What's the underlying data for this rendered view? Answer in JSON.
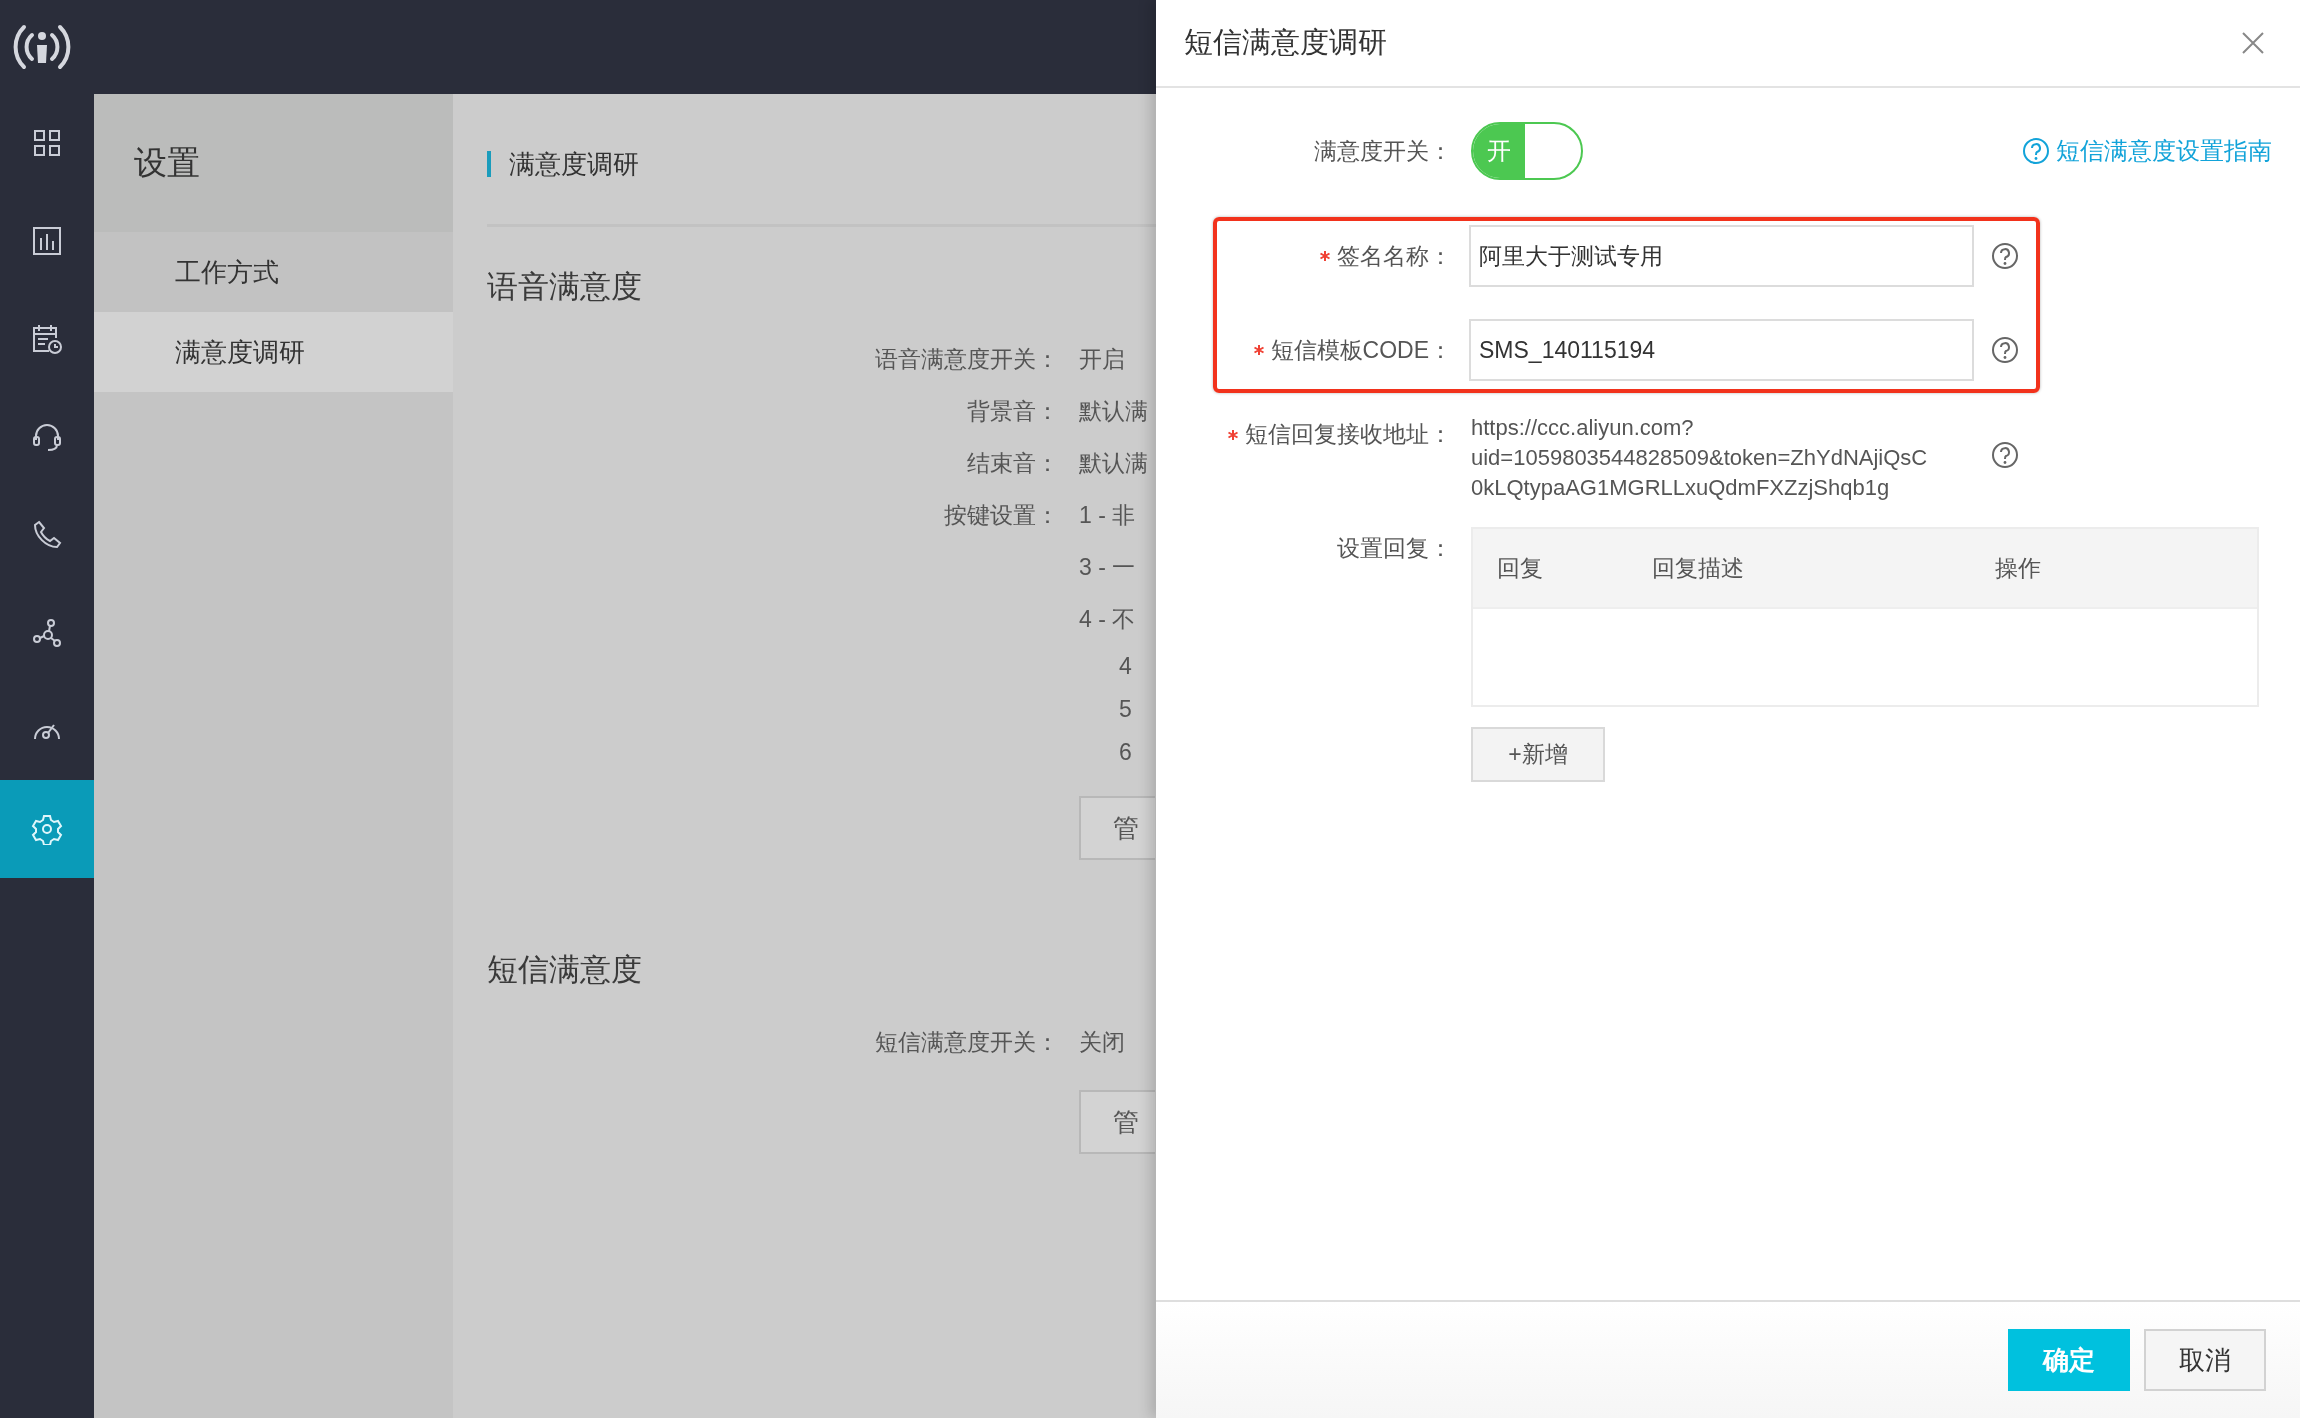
{
  "rail": {
    "items": [
      {
        "selected": false
      },
      {
        "selected": false
      },
      {
        "selected": false
      },
      {
        "selected": false
      },
      {
        "selected": false
      },
      {
        "selected": false
      },
      {
        "selected": false
      },
      {
        "selected": true
      }
    ]
  },
  "settings": {
    "title": "设置",
    "menu": [
      {
        "label": "工作方式",
        "selected": false
      },
      {
        "label": "满意度调研",
        "selected": true
      }
    ]
  },
  "content": {
    "title": "满意度调研",
    "sections": [
      {
        "title": "语音满意度",
        "rows": [
          {
            "kind": "row",
            "label": "语音满意度开关：",
            "value": "开启"
          },
          {
            "kind": "row",
            "label": "背景音：",
            "value": "默认满"
          },
          {
            "kind": "row",
            "label": "结束音：",
            "value": "默认满"
          },
          {
            "kind": "row",
            "label": "按键设置：",
            "value": "1 - 非"
          },
          {
            "kind": "row",
            "value": "3 - 一"
          },
          {
            "kind": "row",
            "value": "4 - 不"
          },
          {
            "kind": "sub",
            "value": "4"
          },
          {
            "kind": "sub",
            "value": "5"
          },
          {
            "kind": "sub",
            "value": "6"
          }
        ],
        "button": "管"
      },
      {
        "title": "短信满意度",
        "rows": [
          {
            "kind": "row",
            "label": "短信满意度开关：",
            "value": "关闭"
          }
        ],
        "button": "管"
      }
    ]
  },
  "drawer": {
    "title": "短信满意度调研",
    "toggle": {
      "label": "满意度开关：",
      "on": true,
      "text": "开"
    },
    "guide_link": "短信满意度设置指南",
    "highlight_frame": true,
    "fields": [
      {
        "label": "签名名称：",
        "required": true,
        "value": "阿里大于测试专用"
      },
      {
        "label": "短信模板CODE：",
        "required": true,
        "value": "SMS_140115194"
      }
    ],
    "reply_url": {
      "label": "短信回复接收地址：",
      "required": true,
      "lines": [
        "https://ccc.aliyun.com?",
        "uid=1059803544828509&token=ZhYdNAjiQsC",
        "0kLQtypaAG1MGRLLxuQdmFXZzjShqb1g"
      ]
    },
    "reply_table": {
      "label": "设置回复：",
      "columns": [
        "回复",
        "回复描述",
        "操作"
      ]
    },
    "add_button": "+新增",
    "buttons": [
      {
        "label": "确定",
        "kind": "primary"
      },
      {
        "label": "取消",
        "kind": "default"
      }
    ]
  }
}
